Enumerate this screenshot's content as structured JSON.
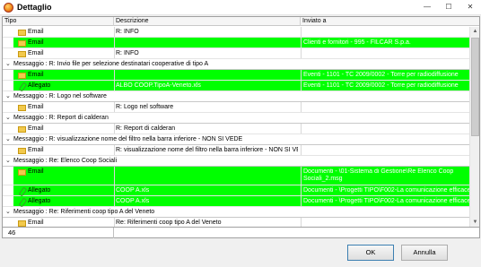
{
  "window": {
    "title": "Dettaglio",
    "min": "—",
    "max": "☐",
    "close": "✕"
  },
  "columns": {
    "tipo": "Tipo",
    "descrizione": "Descrizione",
    "inviato": "Inviato a"
  },
  "rows": [
    {
      "kind": "item",
      "icon": "mail-icon",
      "tipo": "Email",
      "desc": "R: INFO",
      "inv": "",
      "green": false
    },
    {
      "kind": "item",
      "icon": "mail-icon",
      "tipo": "Email",
      "desc": "",
      "inv": "Clienti e fornitori - 995 - FILCAR S.p.a.",
      "green": true
    },
    {
      "kind": "item",
      "icon": "mail-icon",
      "tipo": "Email",
      "desc": "R: INFO",
      "inv": "",
      "green": false
    },
    {
      "kind": "group",
      "text": "Messaggio : R: Invio file per selezione destinatari cooperative di tipo A"
    },
    {
      "kind": "item",
      "icon": "mail-icon",
      "tipo": "Email",
      "desc": "",
      "inv": "Eventi - 1101 - TC 2009/0002 - Torre per radiodiffusione",
      "green": true
    },
    {
      "kind": "item",
      "icon": "clip-icon",
      "tipo": "Allegato",
      "desc": "ALBO COOP.TipoA-Veneto.xls",
      "inv": "Eventi - 1101 - TC 2009/0002 - Torre per radiodiffusione",
      "green": true
    },
    {
      "kind": "group",
      "text": "Messaggio : R: Logo nel software"
    },
    {
      "kind": "item",
      "icon": "mail-icon",
      "tipo": "Email",
      "desc": "R: Logo nel software",
      "inv": "",
      "green": false
    },
    {
      "kind": "group",
      "text": "Messaggio : R: Report di calderan"
    },
    {
      "kind": "item",
      "icon": "mail-icon",
      "tipo": "Email",
      "desc": "R: Report di calderan",
      "inv": "",
      "green": false
    },
    {
      "kind": "group",
      "text": "Messaggio : R: visualizzazione nome del filtro nella barra inferiore - NON SI VEDE"
    },
    {
      "kind": "item",
      "icon": "mail-icon",
      "tipo": "Email",
      "desc": "R: visualizzazione nome del filtro nella barra inferiore - NON SI VEDE",
      "inv": "",
      "green": false
    },
    {
      "kind": "group",
      "text": "Messaggio : Re: Elenco Coop Sociali"
    },
    {
      "kind": "item",
      "icon": "mail-icon",
      "tipo": "Email",
      "desc": "",
      "inv": "Documenti - \\01-Sistema di Gestione\\Re Elenco Coop Sociali_2.msg",
      "green": true,
      "tall": true
    },
    {
      "kind": "item",
      "icon": "clip-icon",
      "tipo": "Allegato",
      "desc": "COOP A.xls",
      "inv": "Documenti - \\Progetti TIPO\\F002-La comunicazione efficace\\",
      "green": true
    },
    {
      "kind": "item",
      "icon": "clip-icon",
      "tipo": "Allegato",
      "desc": "COOP A.xls",
      "inv": "Documenti - \\Progetti TIPO\\F002-La comunicazione efficace\\",
      "green": true
    },
    {
      "kind": "group",
      "text": "Messaggio : Re: Riferimenti coop tipo A del Veneto"
    },
    {
      "kind": "item",
      "icon": "mail-icon",
      "tipo": "Email",
      "desc": "Re: Riferimenti coop tipo A del Veneto",
      "inv": "",
      "green": false
    }
  ],
  "status": {
    "count": "46"
  },
  "buttons": {
    "ok": "OK",
    "cancel": "Annulla"
  },
  "colors": {
    "highlight": "#00ff00"
  }
}
